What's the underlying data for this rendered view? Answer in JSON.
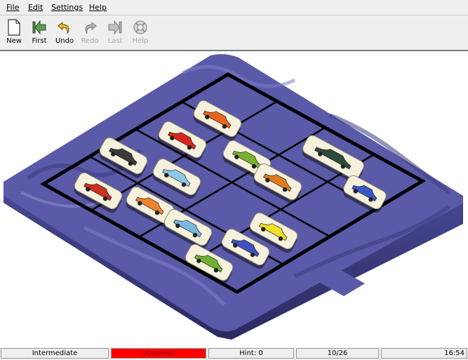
{
  "menu": {
    "file": "File",
    "edit": "Edit",
    "settings": "Settings",
    "help": "Help"
  },
  "toolbar": {
    "new": "New",
    "first": "First",
    "undo": "Undo",
    "redo": "Redo",
    "last": "Last",
    "help": "Help"
  },
  "board": {
    "tiles": [
      {
        "name": "tile-car-orange-hatch",
        "car_color": "#e8641e"
      },
      {
        "name": "tile-tractor-red",
        "car_color": "#d9261c"
      },
      {
        "name": "tile-car-green-jeep",
        "car_color": "#2e4a3a"
      },
      {
        "name": "tile-car-black-sedan",
        "car_color": "#3a3a3a"
      },
      {
        "name": "tile-car-green-beetle",
        "car_color": "#7ab030"
      },
      {
        "name": "tile-car-light-blue",
        "car_color": "#8cc8e8"
      },
      {
        "name": "tile-car-orange-racer",
        "car_color": "#e07a20"
      },
      {
        "name": "tile-car-red-classic",
        "car_color": "#c8321e"
      },
      {
        "name": "tile-car-orange-coupe",
        "car_color": "#f0822a"
      },
      {
        "name": "tile-car-blue-sports",
        "car_color": "#3858c8"
      },
      {
        "name": "tile-car-light-blue-small",
        "car_color": "#78b8e0"
      },
      {
        "name": "tile-car-yellow",
        "car_color": "#f0e028"
      },
      {
        "name": "tile-car-blue-sedan",
        "car_color": "#4050c0"
      },
      {
        "name": "tile-car-green-small",
        "car_color": "#70b030"
      }
    ],
    "board_color": "#5a5aa8"
  },
  "status": {
    "level": "Intermediate",
    "state": "Unsolved",
    "hint": "Hint: 0",
    "moves": "10/26",
    "time": "16:54"
  }
}
